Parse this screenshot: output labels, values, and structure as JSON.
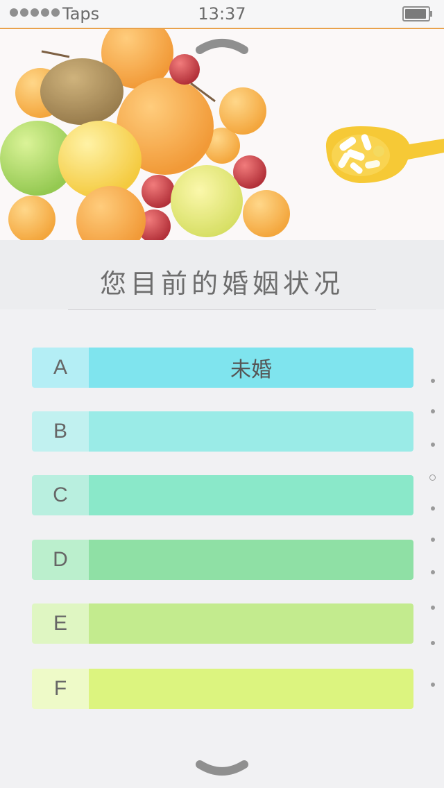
{
  "status_bar": {
    "carrier": "Taps",
    "time": "13:37"
  },
  "question": {
    "title": "您目前的婚姻状况"
  },
  "options": [
    {
      "letter": "A",
      "text": "未婚",
      "letter_bg": "#b4eef5",
      "bar_bg": "#7fe4ee"
    },
    {
      "letter": "B",
      "text": "",
      "letter_bg": "#c1f1f0",
      "bar_bg": "#9aebe7"
    },
    {
      "letter": "C",
      "text": "",
      "letter_bg": "#b9efdf",
      "bar_bg": "#8ae8c9"
    },
    {
      "letter": "D",
      "text": "",
      "letter_bg": "#bbefcd",
      "bar_bg": "#8fe0a5"
    },
    {
      "letter": "E",
      "text": "",
      "letter_bg": "#dff6c2",
      "bar_bg": "#c3eb8e"
    },
    {
      "letter": "F",
      "text": "",
      "letter_bg": "#eefac8",
      "bar_bg": "#dcf47f"
    }
  ],
  "pager": {
    "count": 10,
    "active_index": 3
  },
  "colors": {
    "status_bar_border": "#e9a24c",
    "question_text": "#6d6d6d"
  },
  "icons": {
    "up": "chevron-up-icon",
    "down": "chevron-down-icon",
    "hero": "fruit-and-pills-image"
  }
}
